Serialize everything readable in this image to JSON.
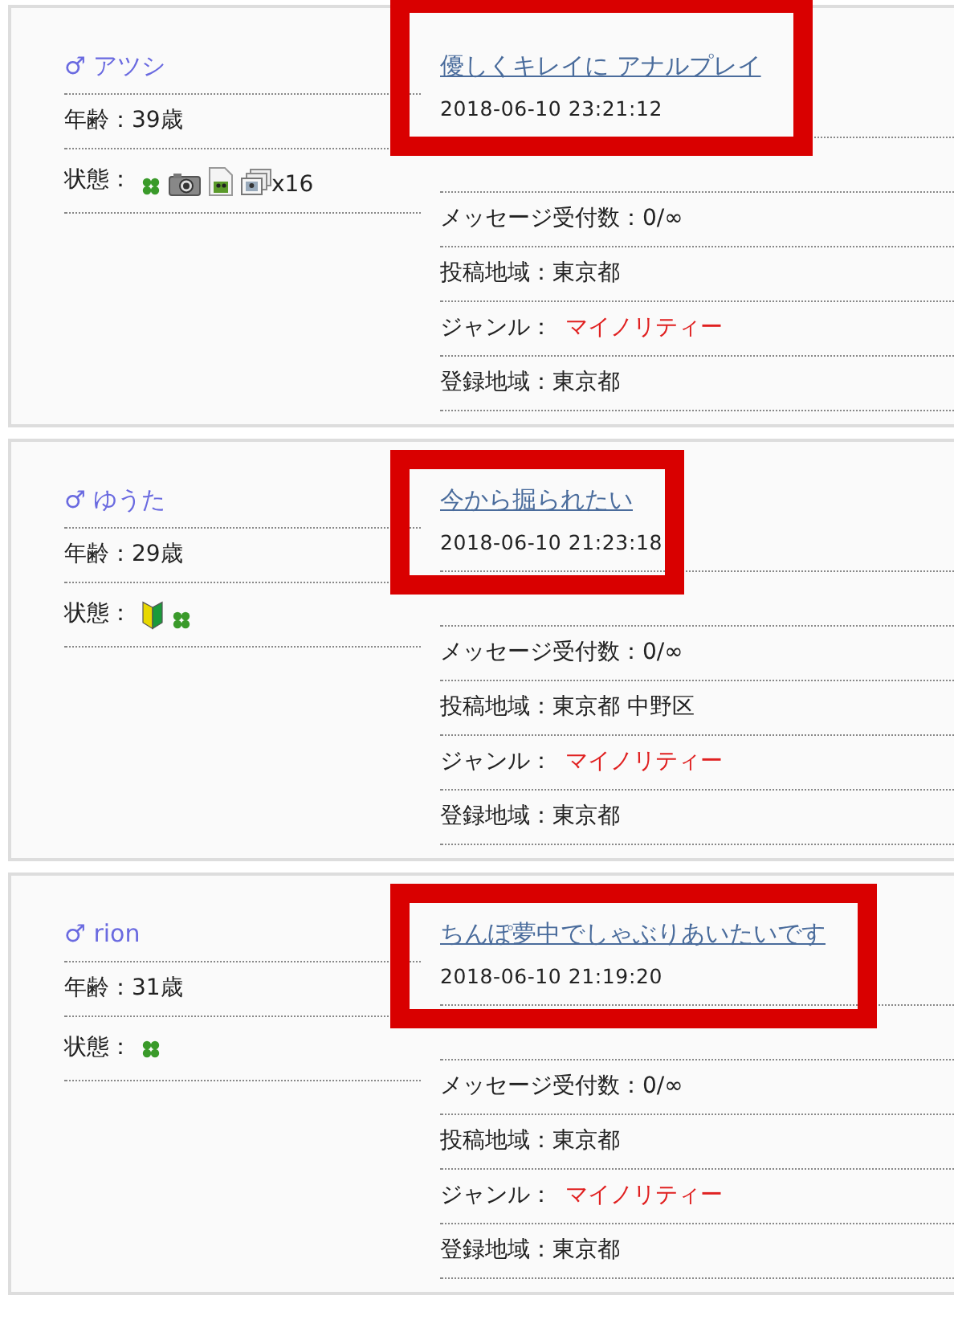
{
  "posts": [
    {
      "user": {
        "gender": "♂",
        "name": "アツシ"
      },
      "age": {
        "label": "年齢：",
        "value": "39歳"
      },
      "status": {
        "label": "状態：",
        "icons": [
          {
            "kind": "clover"
          },
          {
            "kind": "camera"
          },
          {
            "kind": "profile"
          },
          {
            "kind": "photos"
          }
        ],
        "photo_count": "x16"
      },
      "title": "優しくキレイに アナルプレイ",
      "date": "2018-06-10 23:21:12",
      "highlighted": true,
      "info": [
        {
          "label": "メッセージ受付数：",
          "value": "0/∞",
          "kind": "plain"
        },
        {
          "label": "投稿地域：",
          "value": "東京都",
          "kind": "plain"
        },
        {
          "label": "ジャンル：",
          "value": "マイノリティー",
          "kind": "genre"
        },
        {
          "label": "登録地域：",
          "value": "東京都",
          "kind": "plain"
        }
      ]
    },
    {
      "user": {
        "gender": "♂",
        "name": "ゆうた"
      },
      "age": {
        "label": "年齢：",
        "value": "29歳"
      },
      "status": {
        "label": "状態：",
        "icons": [
          {
            "kind": "beginner"
          },
          {
            "kind": "clover"
          }
        ]
      },
      "title": "今から掘られたい",
      "date": "2018-06-10 21:23:18",
      "highlighted": true,
      "info": [
        {
          "label": "メッセージ受付数：",
          "value": "0/∞",
          "kind": "plain"
        },
        {
          "label": "投稿地域：",
          "value": "東京都 中野区",
          "kind": "plain"
        },
        {
          "label": "ジャンル：",
          "value": "マイノリティー",
          "kind": "genre"
        },
        {
          "label": "登録地域：",
          "value": "東京都",
          "kind": "plain"
        }
      ]
    },
    {
      "user": {
        "gender": "♂",
        "name": "rion"
      },
      "age": {
        "label": "年齢：",
        "value": "31歳"
      },
      "status": {
        "label": "状態：",
        "icons": [
          {
            "kind": "clover"
          }
        ]
      },
      "title": "ちんぽ夢中でしゃぶりあいたいです",
      "date": "2018-06-10 21:19:20",
      "highlighted": true,
      "info": [
        {
          "label": "メッセージ受付数：",
          "value": "0/∞",
          "kind": "plain"
        },
        {
          "label": "投稿地域：",
          "value": "東京都",
          "kind": "plain"
        },
        {
          "label": "ジャンル：",
          "value": "マイノリティー",
          "kind": "genre"
        },
        {
          "label": "登録地域：",
          "value": "東京都",
          "kind": "plain"
        }
      ]
    }
  ]
}
